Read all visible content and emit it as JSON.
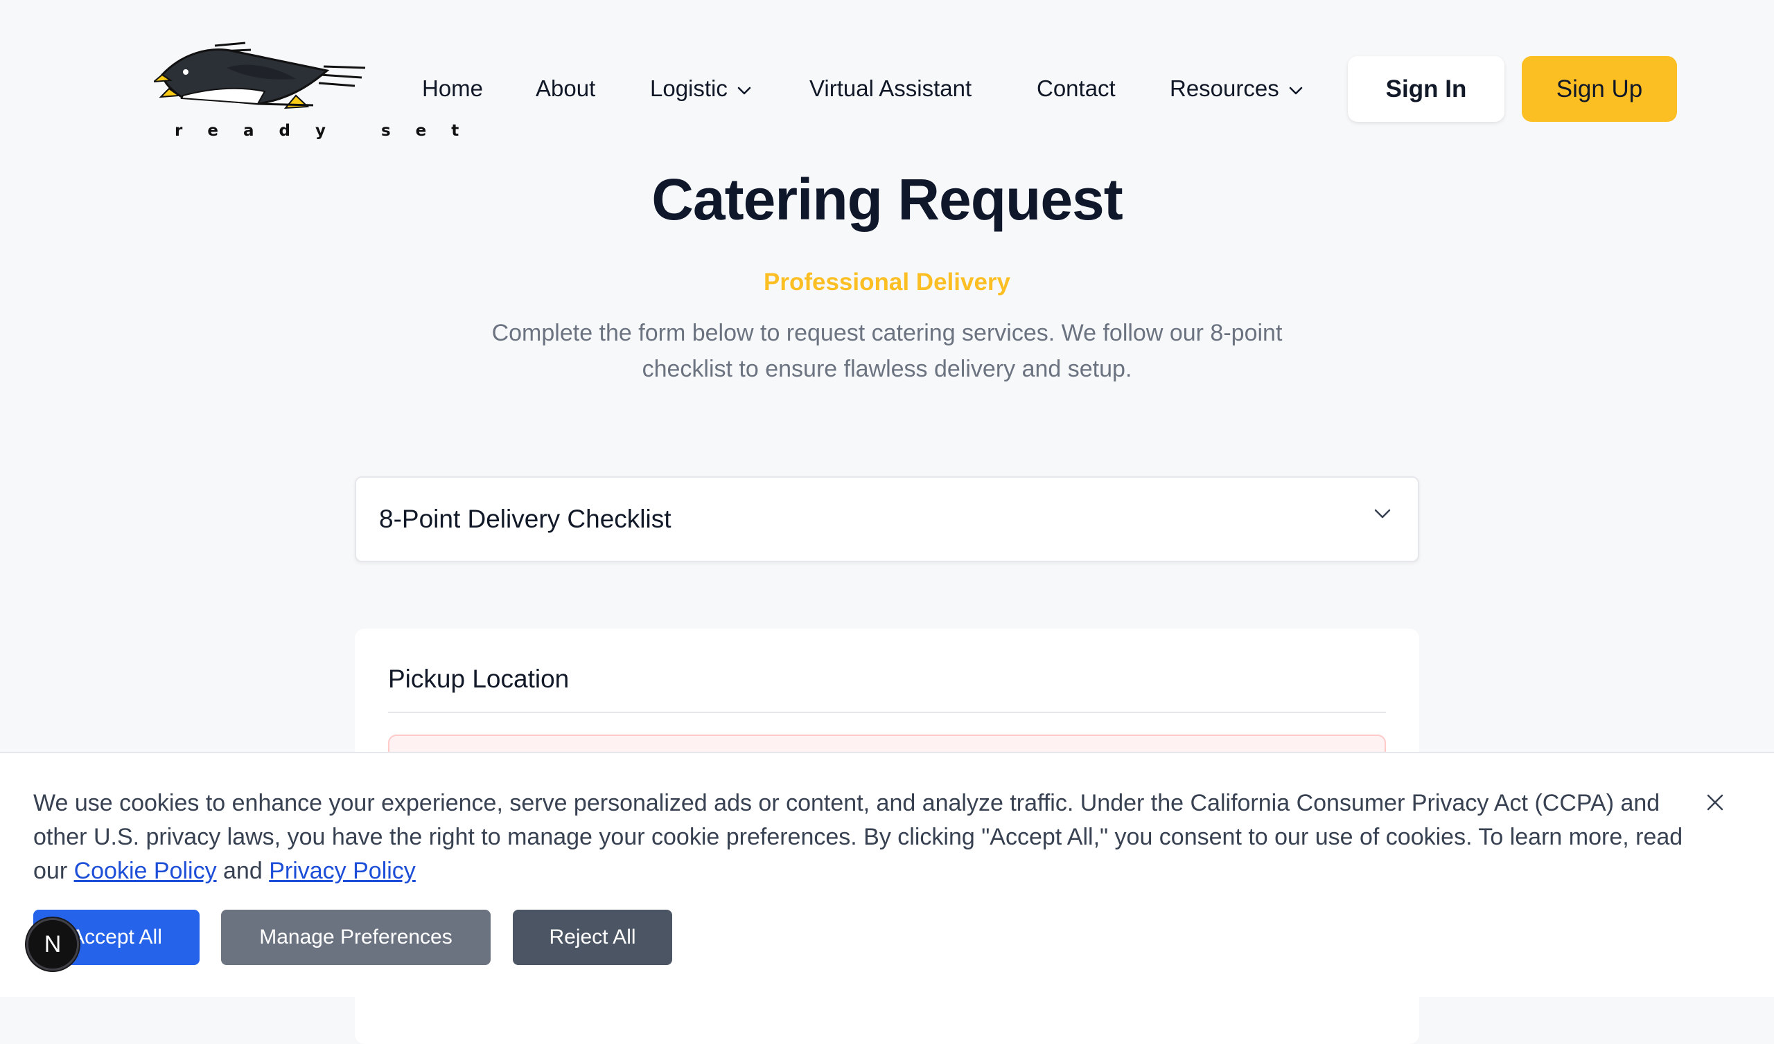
{
  "brand": {
    "logo_text": "r e a d y   s e t"
  },
  "nav": {
    "home": "Home",
    "about": "About",
    "logistic": "Logistic",
    "virtual_assistant": "Virtual Assistant",
    "contact": "Contact",
    "resources": "Resources",
    "sign_in": "Sign In",
    "sign_up": "Sign Up"
  },
  "hero": {
    "title": "Catering Request",
    "subtitle": "Professional Delivery",
    "description": "Complete the form below to request catering services. We follow our 8-point checklist to ensure flawless delivery and setup."
  },
  "checklist": {
    "title": "8-Point Delivery Checklist",
    "icon": "chevron-down-icon"
  },
  "pickup": {
    "title": "Pickup Location"
  },
  "cookie": {
    "text_before": "We use cookies to enhance your experience, serve personalized ads or content, and analyze traffic. Under the California Consumer Privacy Act (CCPA) and other U.S. privacy laws, you have the right to manage your cookie preferences. By clicking \"Accept All,\" you consent to our use of cookies. To learn more, read our ",
    "cookie_policy": "Cookie Policy",
    "and": " and ",
    "privacy_policy": "Privacy Policy",
    "accept_all": "Accept All",
    "manage_preferences": "Manage Preferences",
    "reject_all": "Reject All"
  },
  "dev_badge": {
    "letter": "N"
  },
  "colors": {
    "accent_yellow": "#fbbf24",
    "accept_blue": "#2563eb",
    "link_blue": "#1d4ed8",
    "manage_gray": "#6b7280",
    "reject_gray": "#4b5563",
    "background": "#f7f8fa"
  }
}
